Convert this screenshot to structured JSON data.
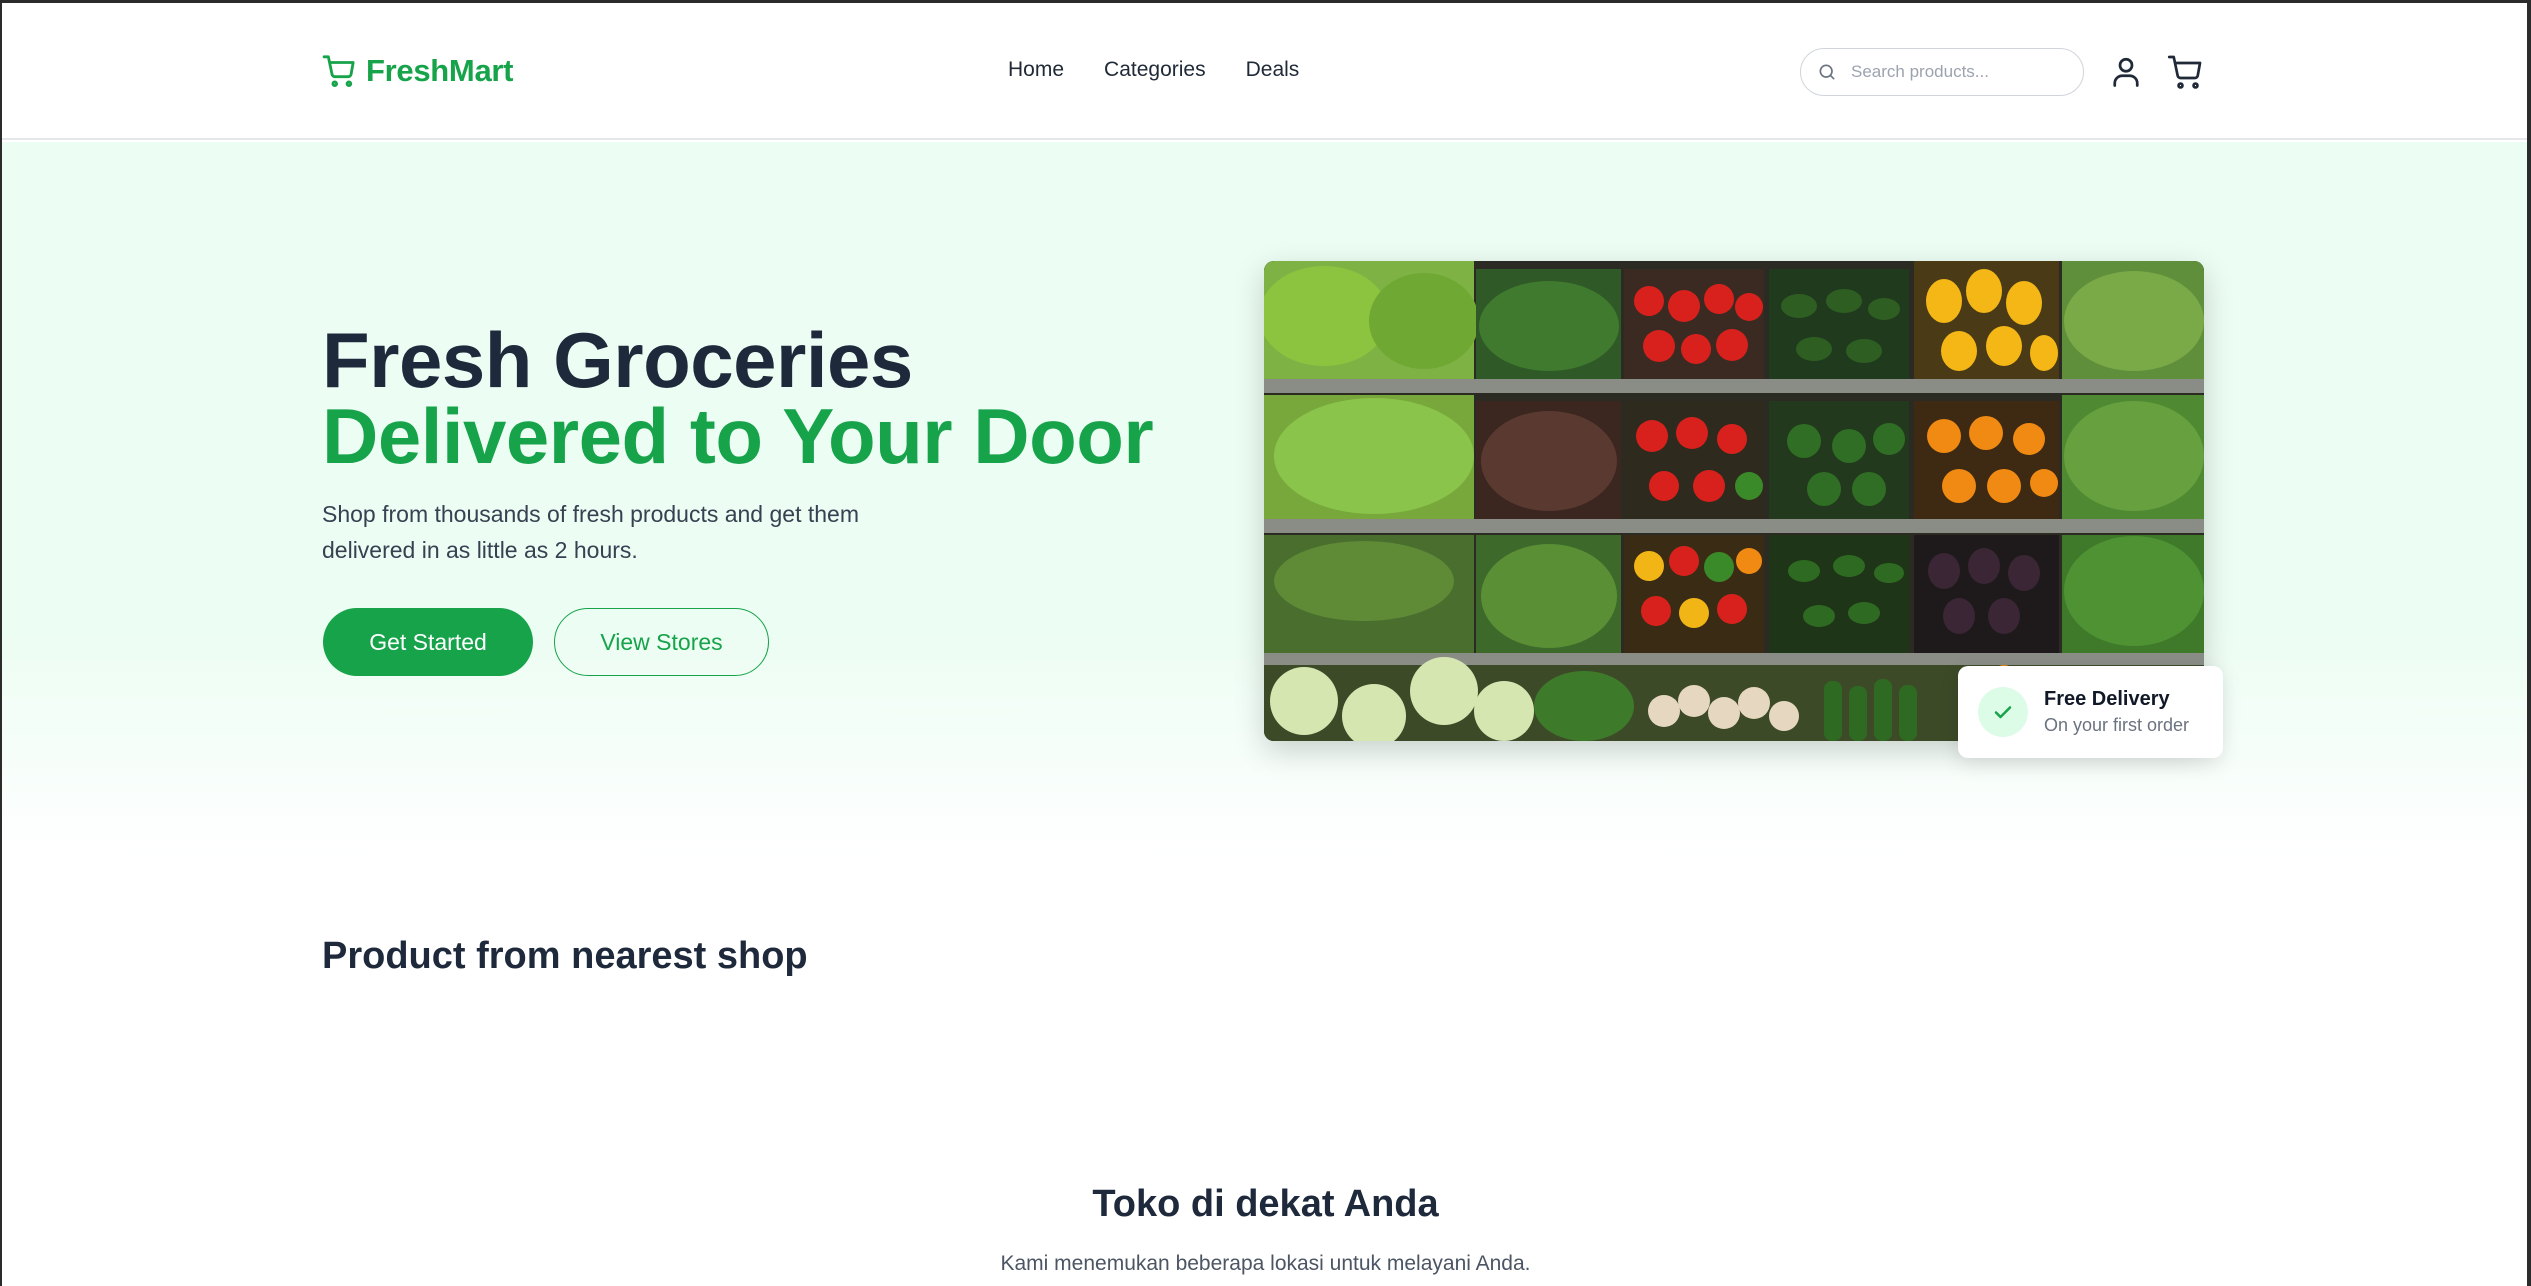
{
  "header": {
    "logo_text": "FreshMart",
    "logo_icon": "cart-icon",
    "nav": [
      {
        "label": "Home"
      },
      {
        "label": "Categories"
      },
      {
        "label": "Deals"
      }
    ],
    "search": {
      "placeholder": "Search products...",
      "value": ""
    },
    "user_icon": "user-icon",
    "cart_icon": "cart-icon"
  },
  "hero": {
    "title_line1": "Fresh Groceries",
    "title_line2": "Delivered to Your Door",
    "subtitle": "Shop from thousands of fresh products and get them delivered in as little as 2 hours.",
    "primary_button": "Get Started",
    "secondary_button": "View Stores",
    "image_alt": "Supermarket produce shelves with vegetables and peppers",
    "badge": {
      "title": "Free Delivery",
      "subtitle": "On your first order",
      "icon": "check-icon"
    }
  },
  "products_section": {
    "title": "Product from nearest shop"
  },
  "stores_section": {
    "title": "Toko di dekat Anda",
    "subtitle": "Kami menemukan beberapa lokasi untuk melayani Anda."
  },
  "colors": {
    "brand_green": "#16a34a",
    "dark_text": "#1e293b",
    "hero_bg": "#ecfdf3"
  }
}
